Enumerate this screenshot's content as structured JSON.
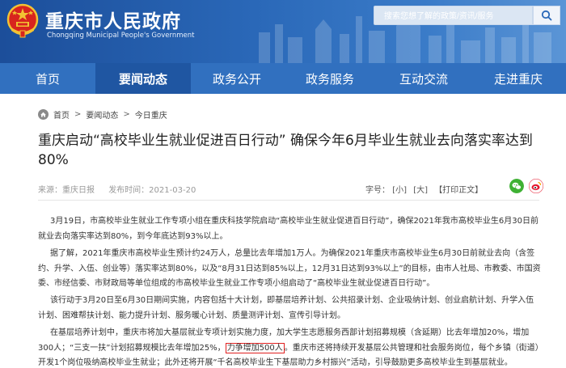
{
  "header": {
    "title": "重庆市人民政府",
    "subtitle": "Chongqing Municipal People's Government",
    "search_placeholder": "搜索您想了解的政策/资讯/服务",
    "search_icon": "search-icon",
    "emblem_icon": "national-emblem-icon"
  },
  "nav": {
    "items": [
      {
        "label": "首页"
      },
      {
        "label": "要闻动态"
      },
      {
        "label": "政务公开"
      },
      {
        "label": "政务服务"
      },
      {
        "label": "互动交流"
      },
      {
        "label": "走进重庆"
      }
    ],
    "active": "要闻动态"
  },
  "breadcrumb": {
    "items": [
      "首页",
      "要闻动态",
      "今日重庆"
    ],
    "separator": ">"
  },
  "article": {
    "title": "重庆启动“高校毕业生就业促进百日行动” 确保今年6月毕业生就业去向落实率达到80%",
    "source": "来源：重庆日报",
    "date": "发布时间：2021-03-20",
    "font_label": "字号：",
    "font_small": "[小]",
    "font_large": "[大]",
    "print": "【打印正文】",
    "paragraphs": {
      "p1": "3月19日，市高校毕业生就业工作专项小组在重庆科技学院启动“高校毕业生就业促进百日行动”，确保2021年我市高校毕业生6月30日前就业去向落实率达到80%，到今年底达到93%以上。",
      "p2": "据了解，2021年重庆市高校毕业生预计约24万人，总量比去年增加1万人。为确保2021年重庆市高校毕业生6月30日前就业去向（含签约、升学、入伍、创业等）落实率达到80%，以及“8月31日达到85%以上，12月31日达到93%以上”的目标，由市人社局、市教委、市国资委、市经信委、市财政局等单位组成的市高校毕业生就业工作专项小组启动了“高校毕业生就业促进百日行动”。",
      "p3": "该行动于3月20日至6月30日期间实施，内容包括十大计划，即基层培养计划、公共招录计划、企业吸纳计划、创业启航计划、升学入伍计划、困难帮扶计划、能力提升计划、服务暖心计划、质量测评计划、宣传引导计划。",
      "p4_before": "在基层培养计划中，重庆市将加大基层就业专项计划实施力度，加大学生志愿服务西部计划招募规模（含延期）比去年增加20%，增加300人；“三支一扶”计划招募规模比去年增加25%，",
      "p4_highlight": "力争增加500人",
      "p4_after": "。重庆市还将持续开发基层公共管理和社会服务岗位，每个乡镇（街道）开发1个岗位吸纳高校毕业生就业；此外还将开展“千名高校毕业生下基层助力乡村振兴”活动，引导鼓励更多高校毕业生到基层就业。"
    }
  },
  "colors": {
    "header_blue": "#1c4e9a",
    "nav_blue": "#3170bf",
    "nav_active": "#1f56a2",
    "highlight_red": "#e02020"
  }
}
